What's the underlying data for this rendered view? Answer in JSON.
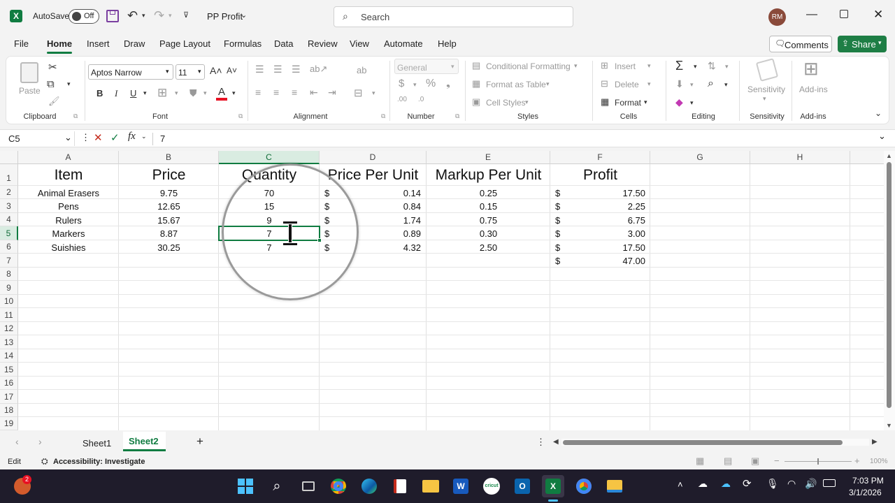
{
  "titlebar": {
    "autosave": "AutoSave",
    "toggle": "Off",
    "filename": "PP Profit",
    "search_placeholder": "Search",
    "user_initials": "RM"
  },
  "menu": [
    "File",
    "Home",
    "Insert",
    "Draw",
    "Page Layout",
    "Formulas",
    "Data",
    "Review",
    "View",
    "Automate",
    "Help"
  ],
  "menu_active": "Home",
  "comments_label": "Comments",
  "share_label": "Share",
  "ribbon": {
    "clipboard": {
      "paste": "Paste",
      "label": "Clipboard"
    },
    "font": {
      "name": "Aptos Narrow",
      "size": "11",
      "bold": "B",
      "italic": "I",
      "underline": "U",
      "label": "Font"
    },
    "alignment": {
      "label": "Alignment"
    },
    "number": {
      "format": "General",
      "label": "Number"
    },
    "styles": {
      "conditional": "Conditional Formatting",
      "format_table": "Format as Table",
      "cell_styles": "Cell Styles",
      "label": "Styles"
    },
    "cells": {
      "insert": "Insert",
      "delete": "Delete",
      "format": "Format",
      "label": "Cells"
    },
    "editing": {
      "label": "Editing"
    },
    "sensitivity": {
      "button": "Sensitivity",
      "label": "Sensitivity"
    },
    "addins": {
      "button": "Add-ins",
      "label": "Add-ins"
    }
  },
  "formula": {
    "namebox": "C5",
    "value": "7"
  },
  "columns": [
    "A",
    "B",
    "C",
    "D",
    "E",
    "F",
    "G",
    "H"
  ],
  "selected_column": "C",
  "rows": [
    "1",
    "2",
    "3",
    "4",
    "5",
    "6",
    "7",
    "8",
    "9",
    "10",
    "11",
    "12",
    "13",
    "14",
    "15",
    "16",
    "17",
    "18",
    "19"
  ],
  "selected_row": "5",
  "headers": {
    "item": "Item",
    "price": "Price",
    "quantity": "Quantity",
    "ppu": "Price Per Unit",
    "markup": "Markup Per Unit",
    "profit": "Profit"
  },
  "data": [
    {
      "item": "Animal Erasers",
      "price": "9.75",
      "qty": "70",
      "cur": "$",
      "ppu": "0.14",
      "markup": "0.25",
      "pcur": "$",
      "profit": "17.50"
    },
    {
      "item": "Pens",
      "price": "12.65",
      "qty": "15",
      "cur": "$",
      "ppu": "0.84",
      "markup": "0.15",
      "pcur": "$",
      "profit": "2.25"
    },
    {
      "item": "Rulers",
      "price": "15.67",
      "qty": "9",
      "cur": "$",
      "ppu": "1.74",
      "markup": "0.75",
      "pcur": "$",
      "profit": "6.75"
    },
    {
      "item": "Markers",
      "price": "8.87",
      "qty": "7",
      "cur": "$",
      "ppu": "0.89",
      "markup": "0.30",
      "pcur": "$",
      "profit": "3.00"
    },
    {
      "item": "Suishies",
      "price": "30.25",
      "qty": "7",
      "cur": "$",
      "ppu": "4.32",
      "markup": "2.50",
      "pcur": "$",
      "profit": "17.50"
    }
  ],
  "total": {
    "cur": "$",
    "value": "47.00"
  },
  "sheets": [
    "Sheet1",
    "Sheet2"
  ],
  "active_sheet": "Sheet2",
  "status": {
    "mode": "Edit",
    "accessibility": "Accessibility: Investigate",
    "zoom": "100%"
  },
  "taskbar": {
    "time": "7:03 PM",
    "date": "3/1/2026",
    "badge": "2"
  },
  "colors": {
    "excel_green": "#107c41",
    "share_green": "#1e7e45",
    "taskbar": "#1f1c2b"
  }
}
